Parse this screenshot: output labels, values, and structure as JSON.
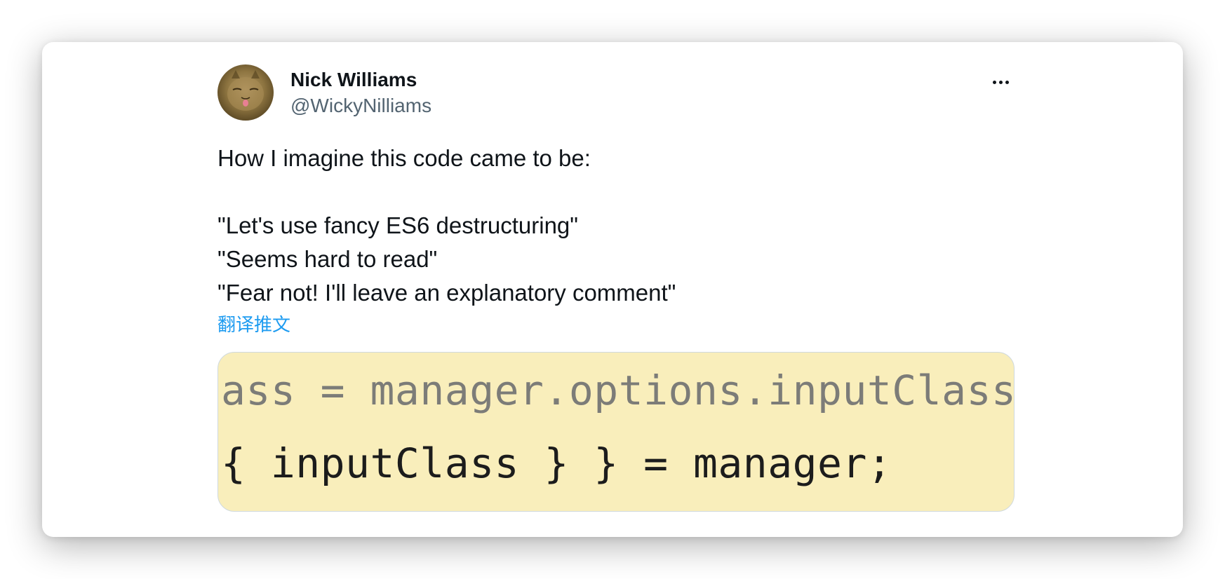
{
  "author": {
    "display_name": "Nick Williams",
    "handle": "@WickyNilliams",
    "avatar_icon": "cat-avatar"
  },
  "tweet": {
    "text": "How I imagine this code came to be:\n\n\"Let's use fancy ES6 destructuring\"\n\"Seems hard to read\"\n\"Fear not! I'll leave an explanatory comment\"",
    "translate_label": "翻译推文"
  },
  "media": {
    "code_lines": [
      "ass = manager.options.inputClass",
      "{ inputClass } } = manager;"
    ],
    "background_color": "#f9eebb"
  },
  "menu": {
    "more_icon": "more-horizontal-icon"
  },
  "colors": {
    "link": "#1d9bf0",
    "primary_text": "#0f1419",
    "secondary_text": "#536471"
  }
}
